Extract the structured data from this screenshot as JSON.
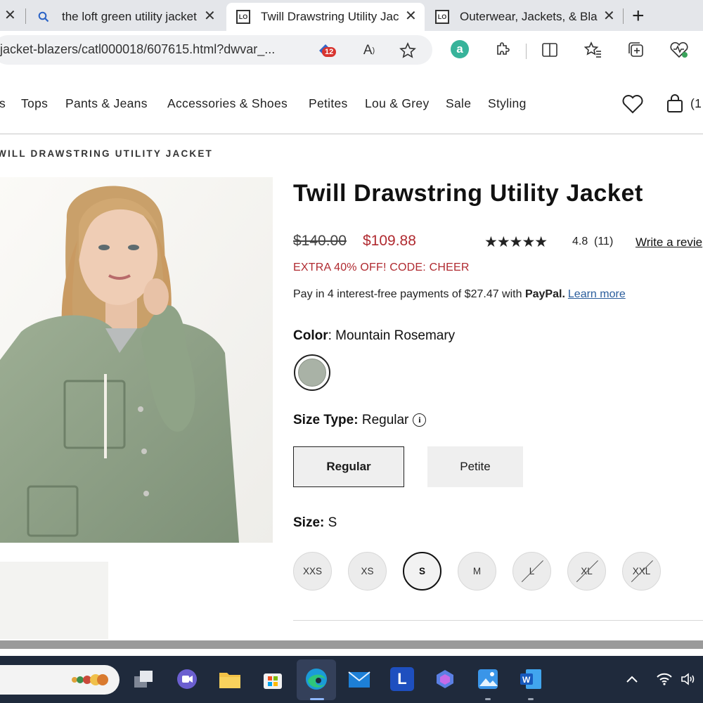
{
  "browser": {
    "tabs": [
      {
        "label": "the loft green utility jacket",
        "icon": "search-icon"
      },
      {
        "label": "Twill Drawstring Utility Jacket",
        "icon": "loft-favicon",
        "active": true
      },
      {
        "label": "Outerwear, Jackets, & Blazers",
        "icon": "loft-favicon"
      }
    ],
    "new_tab_label": "+",
    "url": "jacket-blazers/catl000018/607615.html?dwvar_...",
    "extension_badge": "12",
    "close_glyph": "✕"
  },
  "site": {
    "nav": [
      "s",
      "Tops",
      "Pants & Jeans",
      "Accessories & Shoes",
      "Petites",
      "Lou & Grey",
      "Sale",
      "Styling"
    ],
    "cart_count": "(1"
  },
  "breadcrumb": "WILL DRAWSTRING UTILITY JACKET",
  "product": {
    "title": "Twill Drawstring Utility Jacket",
    "original_price": "$140.00",
    "sale_price": "$109.88",
    "stars": "★★★★★",
    "rating": "4.8",
    "review_count": "(11)",
    "write_review": "Write a revie",
    "promo": "EXTRA 40% OFF! CODE: CHEER",
    "paypal_text": "Pay in 4 interest-free payments of $27.47 with ",
    "paypal_brand": "PayPal.",
    "paypal_link": "Learn more",
    "color_label": "Color",
    "color_value": ": Mountain Rosemary",
    "swatch_color": "#a9b2a6",
    "size_type_label": "Size Type:",
    "size_type_value": " Regular",
    "size_types": [
      "Regular",
      "Petite"
    ],
    "selected_size_type": "Regular",
    "size_label": "Size:",
    "size_value": " S",
    "sizes": [
      {
        "label": "XXS",
        "available": true
      },
      {
        "label": "XS",
        "available": true
      },
      {
        "label": "S",
        "available": true,
        "selected": true
      },
      {
        "label": "M",
        "available": true
      },
      {
        "label": "L",
        "available": false
      },
      {
        "label": "XL",
        "available": false
      },
      {
        "label": "XXL",
        "available": false
      }
    ]
  },
  "colors": {
    "sale_red": "#b02a30",
    "link_blue": "#2a5d9c",
    "taskbar": "#1f2a3c"
  }
}
